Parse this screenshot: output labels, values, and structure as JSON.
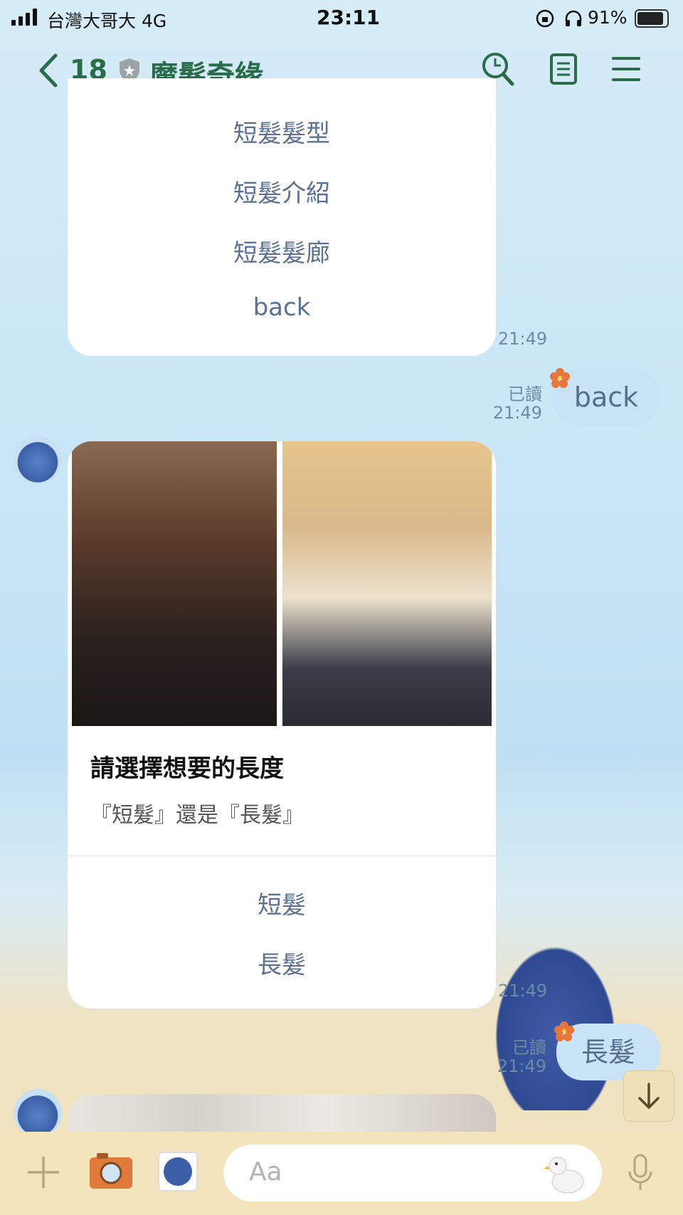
{
  "status_bar": {
    "carrier": "台灣大哥大 4G",
    "time": "23:11",
    "battery": "91%"
  },
  "header": {
    "back_count": "18",
    "title": "魔髮奇緣"
  },
  "messages": {
    "menu1": {
      "items": [
        "短髮髮型",
        "短髮介紹",
        "短髮髮廊",
        "back"
      ],
      "time": "21:49"
    },
    "out1": {
      "read": "已讀",
      "time": "21:49",
      "text": "back"
    },
    "card": {
      "title": "請選擇想要的長度",
      "subtitle": "『短髮』還是『長髮』",
      "options": [
        "短髮",
        "長髮"
      ],
      "time": "21:49"
    },
    "out2": {
      "read": "已讀",
      "time": "21:49",
      "text": "長髮"
    }
  },
  "input": {
    "placeholder": "Aa"
  },
  "icons": {
    "back": "chevron-left-icon",
    "shield": "shield-icon",
    "search": "search-icon",
    "notes": "notes-icon",
    "menu": "hamburger-menu-icon",
    "plus": "plus-icon",
    "camera": "camera-icon",
    "sticker": "sticker-icon",
    "mic": "microphone-icon",
    "scroll": "arrow-down-icon"
  },
  "colors": {
    "accent": "#2a6b4a",
    "link": "#5a7193",
    "outgoing": "#c7e3f5",
    "bar": "#f3e4bd"
  }
}
